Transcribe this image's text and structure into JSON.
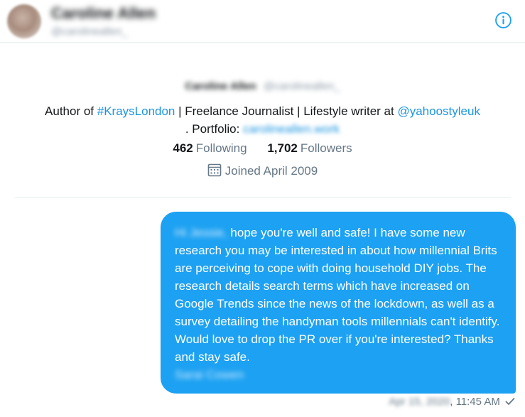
{
  "header": {
    "name": "Caroline Allen",
    "handle": "@carolineallen_",
    "info_icon": "info-circle-icon"
  },
  "profile": {
    "name": "Caroline Allen",
    "handle": "@carolineallen_",
    "bio_prefix": "Author of ",
    "bio_hashtag": "#KraysLondon",
    "bio_middle": " | Freelance Journalist | Lifestyle writer at ",
    "bio_mention": "@yahoostyleuk",
    "bio_portfolio_label": ". Portfolio: ",
    "bio_portfolio_link": "carolineallen.work",
    "following_count": "462",
    "following_label": "Following",
    "followers_count": "1,702",
    "followers_label": "Followers",
    "joined": "Joined April 2009",
    "calendar_icon": "calendar-icon"
  },
  "message": {
    "greeting": "Hi Jessie,",
    "body": "hope you're well and safe! I have some new research you may be interested in about how millennial Brits are perceiving to cope with doing household DIY jobs. The research details search terms which have increased on Google Trends since the news of the lockdown, as well as a survey detailing the handyman tools millennials can't identify. Would love to drop the PR over if you're interested? Thanks and stay safe.",
    "signature": "Sarai Cowen",
    "date": "Apr 15, 2020",
    "time": "11:45 AM",
    "status_icon": "checkmark-icon"
  },
  "colors": {
    "accent": "#1da1f2",
    "link": "#1b95e0",
    "muted": "#657786"
  }
}
